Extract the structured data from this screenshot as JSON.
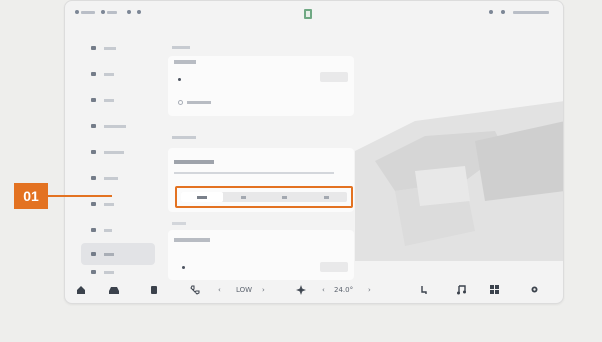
{
  "statusbar": {
    "left_items": [
      "",
      "",
      "",
      ""
    ],
    "right_items": [
      "",
      "",
      ""
    ]
  },
  "sidebar": {
    "items": [
      {
        "label": "",
        "icon": "seat-icon"
      },
      {
        "label": "",
        "icon": "car-icon"
      },
      {
        "label": "",
        "icon": "display-icon"
      },
      {
        "label": "",
        "icon": "settings-icon"
      },
      {
        "label": "",
        "icon": "sound-icon"
      },
      {
        "label": "",
        "icon": "lock-icon"
      },
      {
        "label": "",
        "icon": "light-icon"
      },
      {
        "label": "",
        "icon": "user-icon"
      },
      {
        "label": "",
        "icon": "apps-icon",
        "active": true
      },
      {
        "label": "",
        "icon": "more-icon"
      }
    ]
  },
  "main": {
    "section1_title": "",
    "card1": {
      "label": "",
      "checkbox_label": ""
    },
    "section2_title": "",
    "card2": {
      "label": "",
      "sub": "",
      "options": [
        "",
        "",
        "",
        ""
      ],
      "selected_index": 0
    },
    "section3_title": "",
    "card3": {
      "label": ""
    }
  },
  "callout": {
    "label": "01",
    "color": "#e37221"
  },
  "dock": {
    "items": [
      {
        "icon": "home-icon"
      },
      {
        "icon": "car-icon"
      },
      {
        "icon": "seat-icon"
      },
      {
        "icon": "phone-icon"
      }
    ],
    "fan_label": "LOW",
    "temperature": "24.0°",
    "right_icons": [
      "seat-heat-icon",
      "music-icon",
      "apps-icon",
      "settings-icon"
    ]
  }
}
